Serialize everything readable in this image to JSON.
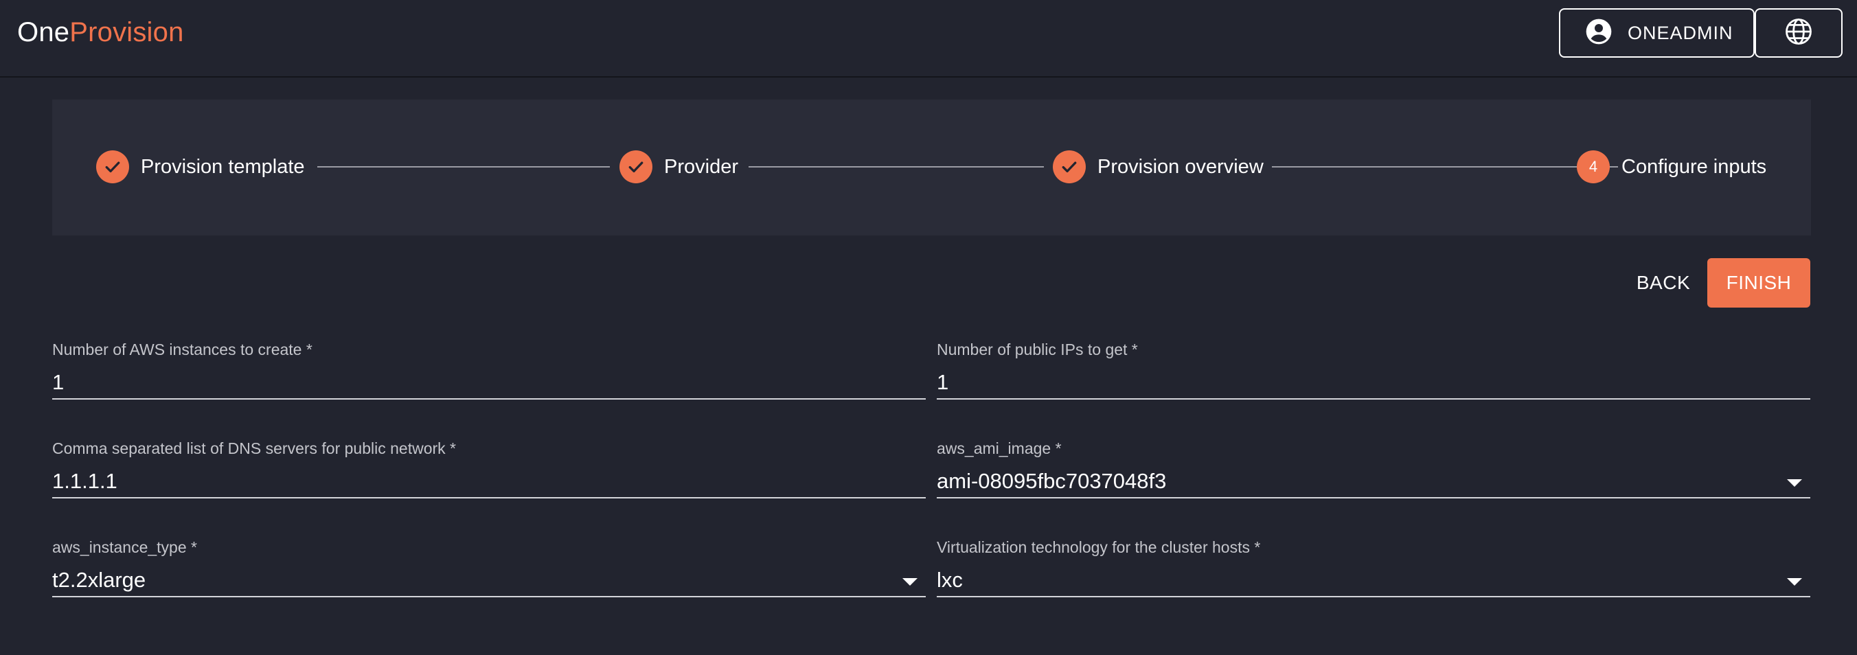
{
  "header": {
    "logo_part1": "One",
    "logo_part2": "Provision",
    "user_label": "ONEADMIN",
    "user_icon": "account-circle-icon",
    "language_icon": "globe-icon"
  },
  "stepper": {
    "steps": [
      {
        "label": "Provision template",
        "state": "completed"
      },
      {
        "label": "Provider",
        "state": "completed"
      },
      {
        "label": "Provision overview",
        "state": "completed"
      },
      {
        "label": "Configure inputs",
        "state": "active",
        "number": "4"
      }
    ]
  },
  "actions": {
    "back_label": "BACK",
    "finish_label": "FINISH"
  },
  "form": {
    "aws_instances": {
      "label": "Number of AWS instances to create *",
      "value": "1"
    },
    "public_ips": {
      "label": "Number of public IPs to get *",
      "value": "1"
    },
    "dns_servers": {
      "label": "Comma separated list of DNS servers for public network *",
      "value": "1.1.1.1"
    },
    "ami_image": {
      "label": "aws_ami_image *",
      "value": "ami-08095fbc7037048f3"
    },
    "instance_type": {
      "label": "aws_instance_type *",
      "value": "t2.2xlarge"
    },
    "virtualization": {
      "label": "Virtualization technology for the cluster hosts *",
      "value": "lxc"
    }
  },
  "colors": {
    "background": "#22242f",
    "panel": "#2a2c38",
    "accent": "#f0734c",
    "text": "#ffffff",
    "label": "#c4c5cb"
  }
}
